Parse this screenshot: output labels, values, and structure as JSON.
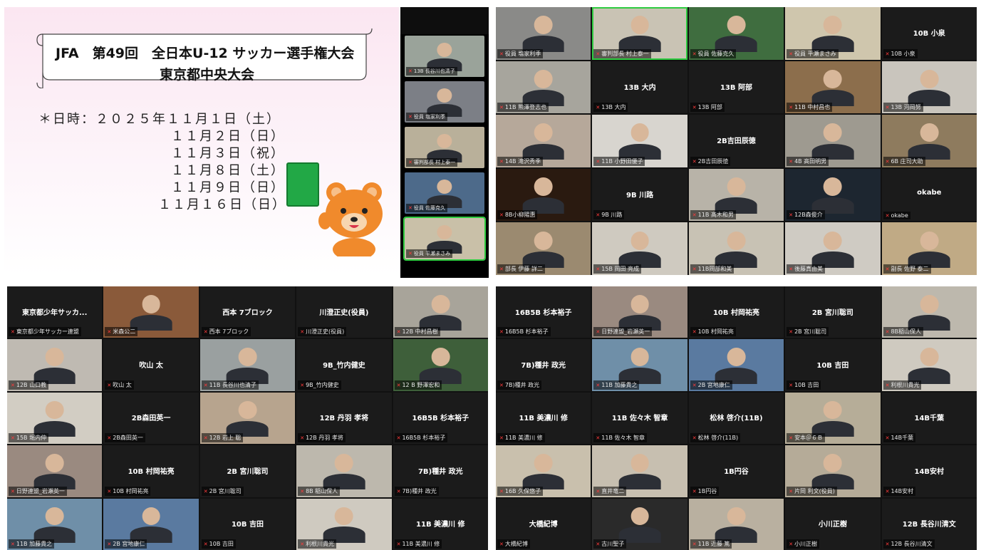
{
  "slide": {
    "title_line1": "JFA　第49回　全日本U-12 サッカー選手権大会",
    "title_line2": "東京都中央大会",
    "dates": [
      "＊日時：２０２５年１１月１日（土）",
      "１１月２日（日）",
      "１１月３日（祝）",
      "１１月８日（土）",
      "１１月９日（日）",
      "１１月１６日（日）"
    ]
  },
  "strip": [
    {
      "name": "13B 長谷川也清子",
      "bg": "#9aa39a",
      "active": false
    },
    {
      "name": "役員 塩家利季",
      "bg": "#7c7f86",
      "active": false
    },
    {
      "name": "審判部長 村上泰一",
      "bg": "#b9b09a",
      "active": false
    },
    {
      "name": "役員 佐藤克久",
      "bg": "#4d6a8a",
      "active": false
    },
    {
      "name": "役員 平瀬まさみ",
      "bg": "#c9c0a8",
      "active": true
    }
  ],
  "grid_tr": [
    {
      "name": "役員 塩家利季",
      "video": true,
      "bg": "#8a8a88"
    },
    {
      "name": "審判部長 村上泰一",
      "video": true,
      "bg": "#c9c3b4",
      "active": true
    },
    {
      "name": "役員 佐藤克久",
      "video": true,
      "bg": "#3f6d3f"
    },
    {
      "name": "役員 平瀬まさみ",
      "video": true,
      "bg": "#cfc6ad"
    },
    {
      "name": "10B 小泉",
      "video": false
    },
    {
      "name": "11B 熊澤登志也",
      "video": true,
      "bg": "#a7a59d"
    },
    {
      "name": "13B 大内",
      "video": false
    },
    {
      "name": "13B 阿部",
      "video": false
    },
    {
      "name": "11B 中村昌也",
      "video": true,
      "bg": "#8c6e4c"
    },
    {
      "name": "13B 河岡努",
      "video": true,
      "bg": "#c9c5bd"
    },
    {
      "name": "14B 滝沢秀季",
      "video": true,
      "bg": "#b6a89a"
    },
    {
      "name": "11B 小野田優子",
      "video": true,
      "bg": "#d8d5cf"
    },
    {
      "name": "2B吉田辰徳",
      "video": false
    },
    {
      "name": "4B 高田明男",
      "video": true,
      "bg": "#9e9a90"
    },
    {
      "name": "6B 庄司大助",
      "video": true,
      "bg": "#8e7b5e"
    },
    {
      "name": "8B小柳陽惠",
      "video": true,
      "bg": "#2a1a10"
    },
    {
      "name": "9B 川路",
      "video": false
    },
    {
      "name": "11B 髙木和男",
      "video": true,
      "bg": "#b8b3a8"
    },
    {
      "name": "12B森俊介",
      "video": true,
      "bg": "#1d2630"
    },
    {
      "name": "okabe",
      "video": false
    },
    {
      "name": "部長 伊藤 詳二",
      "video": true,
      "bg": "#9b8a70"
    },
    {
      "name": "15B 岡田 亮成",
      "video": true,
      "bg": "#cfcac0"
    },
    {
      "name": "11B岡部和美",
      "video": true,
      "bg": "#c8c2b4"
    },
    {
      "name": "後藤真由美",
      "video": true,
      "bg": "#cfcbc3"
    },
    {
      "name": "副長 佐野 泰二",
      "video": true,
      "bg": "#c0aa85"
    }
  ],
  "grid_bl": [
    {
      "name": "東京都少年サッカー連盟",
      "label": "東京都少年サッカ...",
      "video": false
    },
    {
      "name": "米森公二",
      "video": true,
      "bg": "#8a5a3a"
    },
    {
      "name": "西本 7ブロック",
      "video": false
    },
    {
      "name": "川澄正史(役員)",
      "video": false
    },
    {
      "name": "12B 中村昌樹",
      "video": true,
      "bg": "#a8a49a"
    },
    {
      "name": "12B 山口教",
      "video": true,
      "bg": "#bfbab2"
    },
    {
      "name": "吹山 太",
      "video": false
    },
    {
      "name": "11B 長谷川也清子",
      "video": true,
      "bg": "#9aa0a0"
    },
    {
      "name": "9B_竹内健史",
      "video": false
    },
    {
      "name": "12 B 野澤宏和",
      "video": true,
      "bg": "#3e5f3a"
    },
    {
      "name": "15B 堀内伸",
      "video": true,
      "bg": "#d2cdc3"
    },
    {
      "name": "2B森田英一",
      "video": false
    },
    {
      "name": "12B 岩上 聡",
      "video": true,
      "bg": "#b7a48e"
    },
    {
      "name": "12B 丹羽 孝将",
      "video": false
    },
    {
      "name": "16B5B 杉本裕子",
      "video": false
    },
    {
      "name": "日野連盟_岩瀬英一",
      "video": true,
      "bg": "#9a8a80"
    },
    {
      "name": "10B 村岡祐亮",
      "video": false
    },
    {
      "name": "2B 宮川聡司",
      "video": false
    },
    {
      "name": "8B 稲山保人",
      "video": true,
      "bg": "#bdb8ad"
    },
    {
      "name": "7B)種井 政光",
      "video": false
    },
    {
      "name": "11B 加藤貴之",
      "video": true,
      "bg": "#6f8fa8"
    },
    {
      "name": "2B 宮地康仁",
      "video": true,
      "bg": "#5a7aa0"
    },
    {
      "name": "10B 吉田",
      "video": false
    },
    {
      "name": "利根川貴光",
      "video": true,
      "bg": "#cfcac0"
    },
    {
      "name": "11B 美濃川 修",
      "video": false
    }
  ],
  "grid_br": [
    {
      "name": "16B5B 杉本裕子",
      "video": false
    },
    {
      "name": "日野連盟_岩瀬英一",
      "video": true,
      "bg": "#9a8a80"
    },
    {
      "name": "10B 村岡祐亮",
      "video": false
    },
    {
      "name": "2B 宮川聡司",
      "video": false
    },
    {
      "name": "8B稲山保人",
      "video": true,
      "bg": "#bdb8ad"
    },
    {
      "name": "7B)種井 政光",
      "video": false
    },
    {
      "name": "11B 加藤貴之",
      "video": true,
      "bg": "#6f8fa8"
    },
    {
      "name": "2B 宮地康仁",
      "video": true,
      "bg": "#5a7aa0"
    },
    {
      "name": "10B 吉田",
      "video": false
    },
    {
      "name": "利根川貴光",
      "video": true,
      "bg": "#cfcac0"
    },
    {
      "name": "11B 美濃川 修",
      "video": false
    },
    {
      "name": "11B 佐々木 智章",
      "video": false
    },
    {
      "name": "松林 啓介(11B)",
      "video": false
    },
    {
      "name": "安本＠６Ｂ",
      "video": true,
      "bg": "#b6ad98"
    },
    {
      "name": "14B千葉",
      "video": false
    },
    {
      "name": "16B 久保悠子",
      "video": true,
      "bg": "#c9c0ad"
    },
    {
      "name": "直井竜二",
      "video": true,
      "bg": "#c7bfb0"
    },
    {
      "name": "1B円谷",
      "video": false
    },
    {
      "name": "片岡 利文(役員)",
      "video": true,
      "bg": "#b5ab98"
    },
    {
      "name": "14B安村",
      "video": false
    },
    {
      "name": "大橋紀博",
      "video": false
    },
    {
      "name": "古川聖子",
      "video": true,
      "bg": "#2a2a2a"
    },
    {
      "name": "11B 近藤 篤",
      "video": true,
      "bg": "#b9b0a0"
    },
    {
      "name": "小川正樹",
      "video": false
    },
    {
      "name": "12B 長谷川清文",
      "video": false
    }
  ]
}
